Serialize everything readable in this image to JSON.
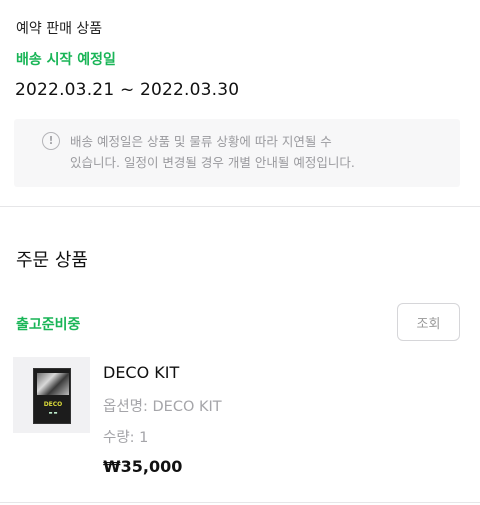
{
  "preorder": {
    "sale_type": "예약 판매 상품",
    "ship_start_label": "배송 시작 예정일",
    "ship_date_range": "2022.03.21 ~ 2022.03.30",
    "notice_icon_glyph": "!",
    "notice_line1": "배송 예정일은 상품 및 물류 상황에 따라 지연될 수",
    "notice_line2": "있습니다. 일정이 변경될 경우 개별 안내될 예정입니다."
  },
  "order": {
    "section_title": "주문 상품",
    "status_label": "출고준비중",
    "lookup_button": "조회",
    "item": {
      "name": "DECO KIT",
      "option": "옵션명: DECO KIT",
      "quantity": "수량: 1",
      "price": "₩35,000",
      "image_icon": "product-box-image"
    }
  },
  "colors": {
    "accent_green": "#19b557",
    "muted_text": "#a5a5a9",
    "notice_bg": "#f7f7f8"
  }
}
